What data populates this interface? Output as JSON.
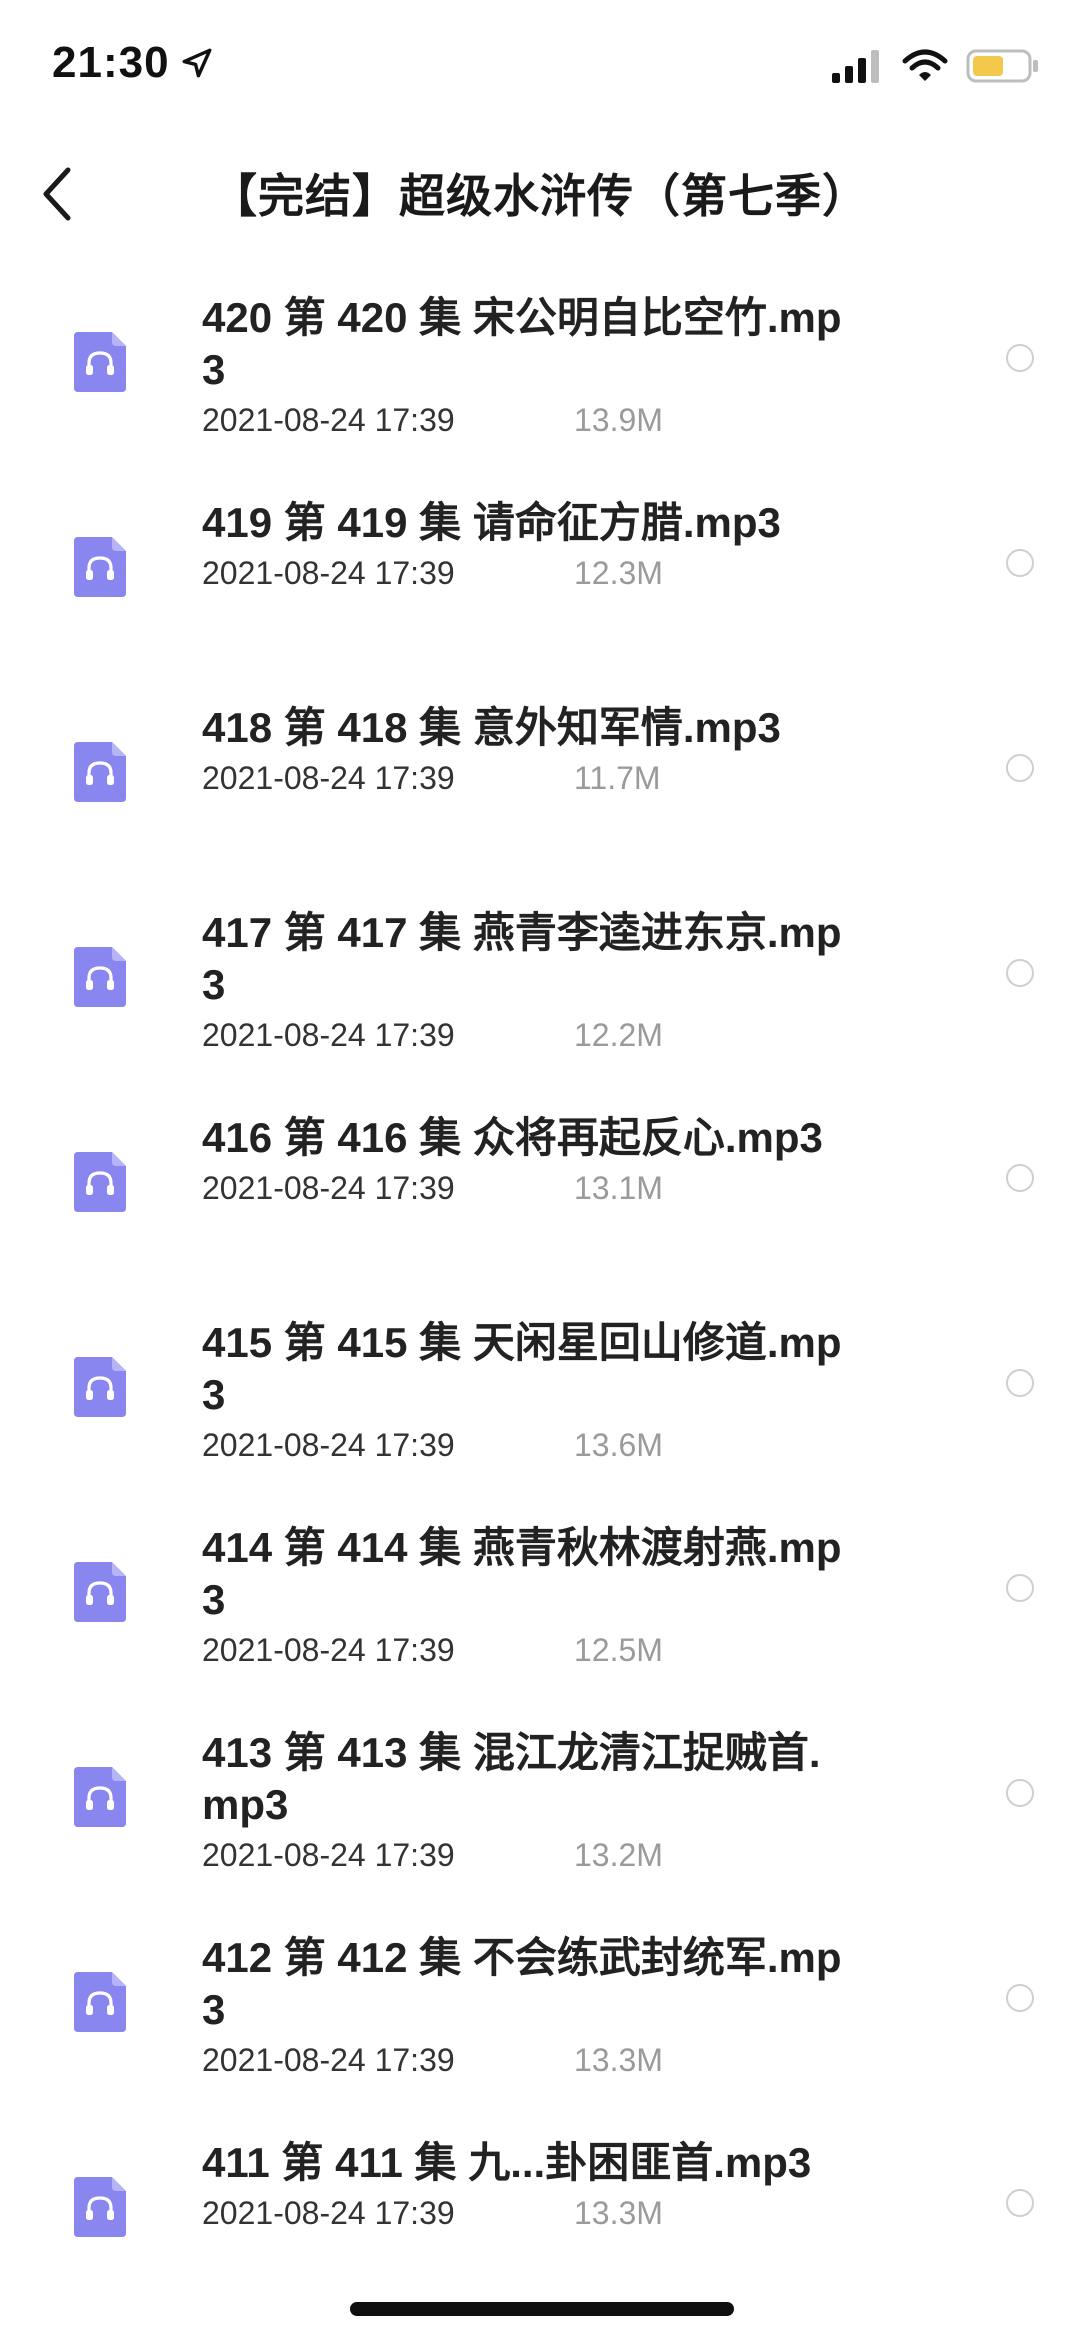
{
  "status_bar": {
    "time": "21:30",
    "icons": [
      "location-arrow-icon",
      "cellular-signal-icon",
      "wifi-icon",
      "battery-icon"
    ],
    "battery_color": "#f2c94c"
  },
  "nav": {
    "back_icon": "chevron-left-icon",
    "title": "【完结】超级水浒传（第七季）"
  },
  "colors": {
    "file_icon": "#8a86f0",
    "radio_border": "#cfcfcf",
    "size_text": "#9a9a9a"
  },
  "files": [
    {
      "name": "420 第 420 集 宋公明自比空竹.mp3",
      "date": "2021-08-24 17:39",
      "size": "13.9M"
    },
    {
      "name": "419 第 419 集 请命征方腊.mp3",
      "date": "2021-08-24 17:39",
      "size": "12.3M"
    },
    {
      "name": "418 第 418 集 意外知军情.mp3",
      "date": "2021-08-24 17:39",
      "size": "11.7M"
    },
    {
      "name": "417 第 417 集 燕青李逵进东京.mp3",
      "date": "2021-08-24 17:39",
      "size": "12.2M"
    },
    {
      "name": "416 第 416 集 众将再起反心.mp3",
      "date": "2021-08-24 17:39",
      "size": "13.1M"
    },
    {
      "name": "415 第 415 集 天闲星回山修道.mp3",
      "date": "2021-08-24 17:39",
      "size": "13.6M"
    },
    {
      "name": "414 第 414 集 燕青秋林渡射燕.mp3",
      "date": "2021-08-24 17:39",
      "size": "12.5M"
    },
    {
      "name": "413 第 413 集 混江龙清江捉贼首.mp3",
      "date": "2021-08-24 17:39",
      "size": "13.2M"
    },
    {
      "name": "412 第 412 集 不会练武封统军.mp3",
      "date": "2021-08-24 17:39",
      "size": "13.3M"
    },
    {
      "name": "411 第 411 集 九...卦困匪首.mp3",
      "date": "2021-08-24 17:39",
      "size": "13.3M"
    }
  ]
}
